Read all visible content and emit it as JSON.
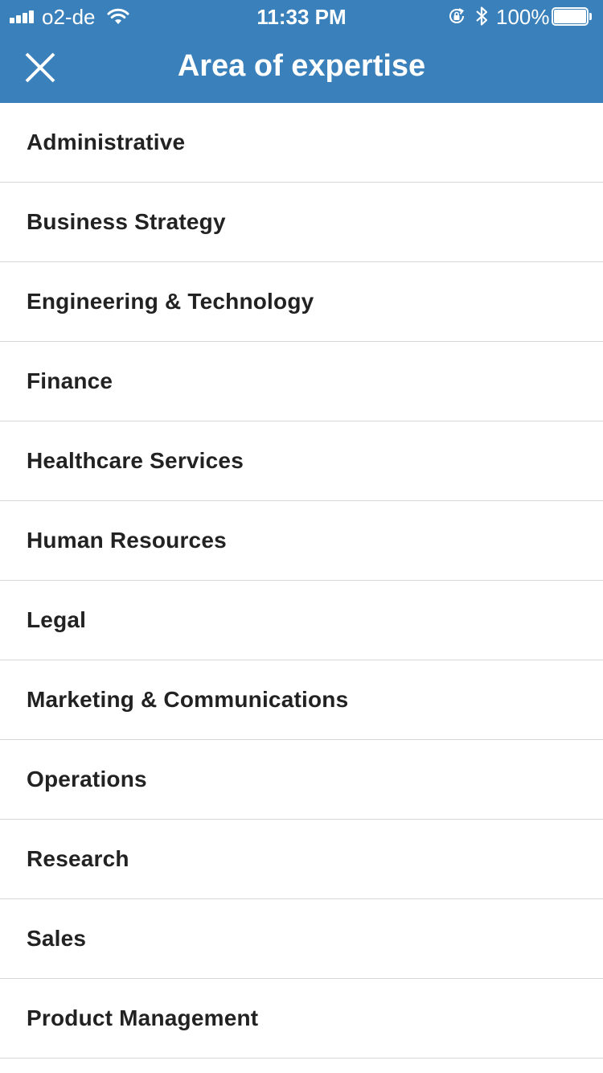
{
  "status_bar": {
    "carrier": "o2-de",
    "time": "11:33 PM",
    "battery_percent": "100%",
    "battery_level": 1.0,
    "icons": [
      "signal-icon",
      "wifi-icon",
      "rotation-lock-icon",
      "bluetooth-icon",
      "battery-icon"
    ]
  },
  "header": {
    "title": "Area of expertise",
    "close_icon": "close-icon",
    "background_color": "#3a80bb"
  },
  "options": [
    {
      "label": "Administrative"
    },
    {
      "label": "Business Strategy"
    },
    {
      "label": "Engineering & Technology"
    },
    {
      "label": "Finance"
    },
    {
      "label": "Healthcare Services"
    },
    {
      "label": "Human Resources"
    },
    {
      "label": "Legal"
    },
    {
      "label": "Marketing & Communications"
    },
    {
      "label": "Operations"
    },
    {
      "label": "Research"
    },
    {
      "label": "Sales"
    },
    {
      "label": "Product Management"
    }
  ]
}
